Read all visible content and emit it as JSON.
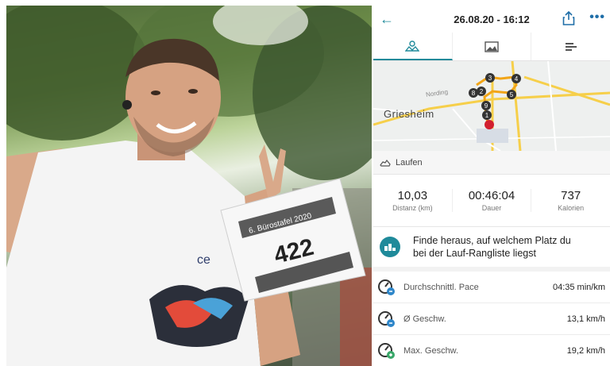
{
  "header": {
    "title": "26.08.20 - 16:12"
  },
  "tabs": [
    {
      "icon": "map-icon",
      "active": true
    },
    {
      "icon": "image-icon",
      "active": false
    },
    {
      "icon": "bars-icon",
      "active": false
    }
  ],
  "map": {
    "town": "Griesheim",
    "street": "Nording",
    "markers": [
      "3",
      "4",
      "8",
      "2",
      "5",
      "9",
      "1"
    ]
  },
  "photo": {
    "bib_event": "6. Bürostafel 2020",
    "bib_number": "422",
    "shirt_text": "ce"
  },
  "activity": {
    "label": "Laufen"
  },
  "stats": [
    {
      "value": "10,03",
      "label": "Distanz (km)"
    },
    {
      "value": "00:46:04",
      "label": "Dauer"
    },
    {
      "value": "737",
      "label": "Kalorien"
    }
  ],
  "promo": {
    "line1": "Finde heraus, auf welchem Platz du",
    "line2": "bei der Lauf-Rangliste liegst"
  },
  "metrics": [
    {
      "label": "Durchschnittl. Pace",
      "value": "04:35 min/km"
    },
    {
      "label": "Ø Geschw.",
      "value": "13,1 km/h"
    },
    {
      "label": "Max. Geschw.",
      "value": "19,2 km/h"
    }
  ],
  "colors": {
    "accent": "#1f8a9a",
    "route": "#f2a517",
    "road": "#f6cf4a"
  }
}
